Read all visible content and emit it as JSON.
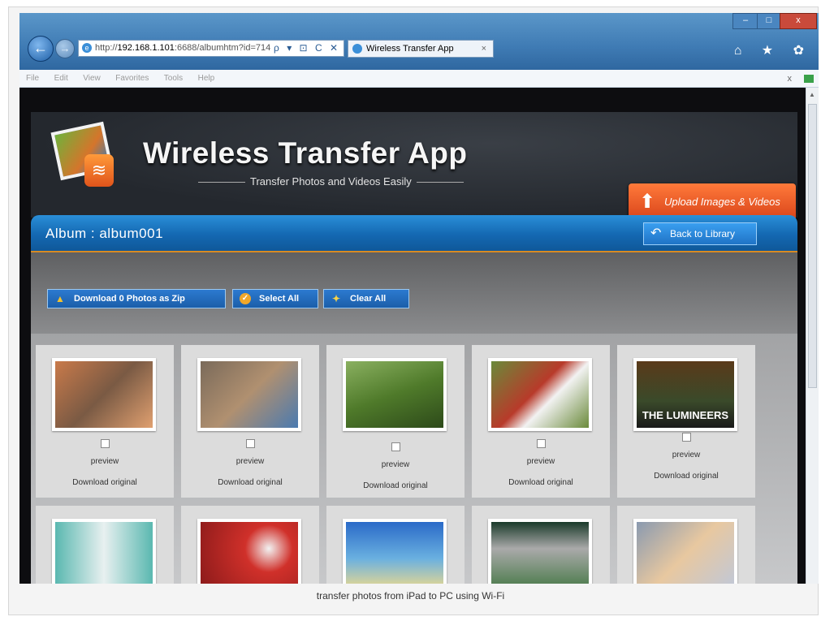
{
  "browser": {
    "back_icon": "back-arrow-icon",
    "forward_icon": "forward-arrow-icon",
    "address_prefix": "http://",
    "address_host": "192.168.1.101",
    "address_rest": ":6688/albumhtm?id=714",
    "address_controls": "ρ ▾ ⊡ C ✕",
    "tab_title": "Wireless Transfer App",
    "tab_close": "×",
    "window_controls": {
      "minimize": "–",
      "maximize": "□",
      "close": "x"
    },
    "toolbar_icons": "⌂ ★ ✿",
    "menu": [
      "File",
      "Edit",
      "View",
      "Favorites",
      "Tools",
      "Help"
    ],
    "menu_right": "x"
  },
  "header": {
    "title": "Wireless Transfer App",
    "subtitle": "Transfer Photos and Videos Easily",
    "upload_label": "Upload Images & Videos"
  },
  "album": {
    "title": "Album : album001",
    "back_label": "Back to Library"
  },
  "toolbar": {
    "download_zip_label": "Download 0 Photos as Zip",
    "select_all_label": "Select All",
    "clear_all_label": "Clear All"
  },
  "photos": [
    {
      "preview": "preview",
      "download": "Download original",
      "colors": [
        "#c97a4a",
        "#7a5a44",
        "#e0a070"
      ]
    },
    {
      "preview": "preview",
      "download": "Download original",
      "colors": [
        "#7a6a5a",
        "#b09070",
        "#4a7ab0"
      ]
    },
    {
      "preview": "preview",
      "download": "Download original",
      "colors": [
        "#4f7a2a",
        "#8ab060",
        "#2d4a1a"
      ]
    },
    {
      "preview": "preview",
      "download": "Download original",
      "colors": [
        "#b83a2a",
        "#f2f2f2",
        "#6a8a3a"
      ]
    },
    {
      "preview": "preview",
      "download": "Download original",
      "colors": [
        "#5a3a1a",
        "#3a4a2a",
        "#1a1a1a"
      ],
      "overlay": "THE LUMINEERS"
    },
    {
      "colors": [
        "#5ab8b0",
        "#e8f0f0",
        "#2a2a2a"
      ]
    },
    {
      "colors": [
        "#8a1a1a",
        "#d0302a",
        "#f2f2f2"
      ]
    },
    {
      "colors": [
        "#2a6ac8",
        "#e8d890",
        "#6ab0e0"
      ]
    },
    {
      "colors": [
        "#1a3a2a",
        "#4a7a4a",
        "#aaaaaa"
      ]
    },
    {
      "colors": [
        "#c0c8d8",
        "#e8c8a0",
        "#8a9ab0"
      ]
    }
  ],
  "caption": "transfer photos from iPad to PC using Wi-Fi"
}
